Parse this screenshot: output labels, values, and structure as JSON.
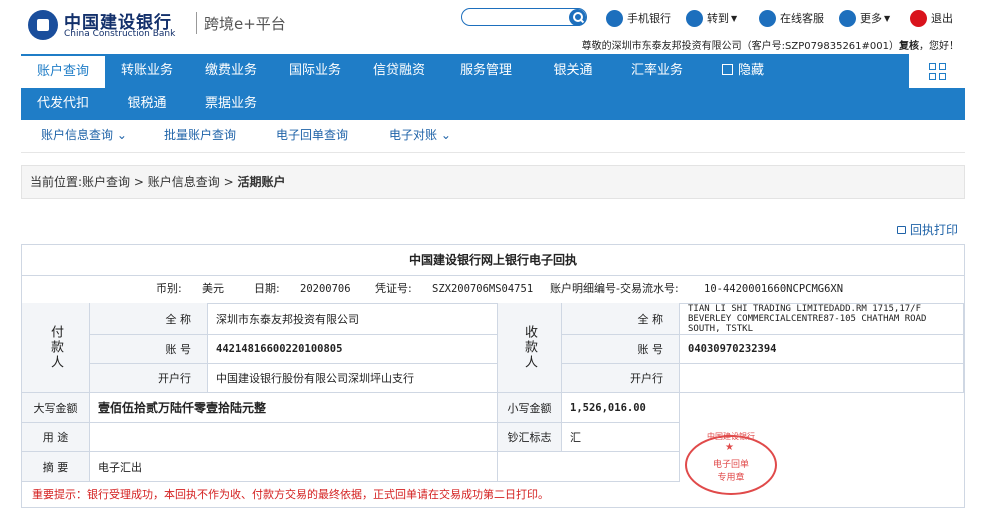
{
  "header": {
    "bank_name_cn": "中国建设银行",
    "bank_name_en": "China Construction Bank",
    "platform": "跨境e+平台",
    "search_placeholder": "",
    "tools": {
      "mobile": "手机银行",
      "goto": "转到",
      "service": "在线客服",
      "more": "更多",
      "logout": "退出"
    },
    "welcome_prefix": "尊敬的深圳市东泰友邦投资有限公司（客户号:SZP079835261#001）",
    "welcome_name": "复核",
    "welcome_suffix": "，您好！"
  },
  "nav": {
    "row1": [
      "账户查询",
      "转账业务",
      "缴费业务",
      "国际业务",
      "信贷融资",
      "服务管理",
      "银关通",
      "汇率业务",
      "隐藏"
    ],
    "row2": [
      "代发代扣",
      "银税通",
      "票据业务"
    ],
    "sub": [
      "账户信息查询",
      "批量账户查询",
      "电子回单查询",
      "电子对账"
    ]
  },
  "breadcrumb": {
    "prefix": "当前位置:",
    "path1": "账户查询",
    "path2": "账户信息查询",
    "current": "活期账户"
  },
  "print_label": "回执打印",
  "receipt": {
    "title": "中国建设银行网上银行电子回执",
    "currency_label": "币别:",
    "currency": "美元",
    "date_label": "日期:",
    "date": "20200706",
    "voucher_label": "凭证号:",
    "voucher": "SZX200706MS04751",
    "detail_label": "账户明细编号-交易流水号:",
    "detail": "10-4420001660NCPCMG6XN",
    "payer": {
      "side_label": "付款人",
      "name_label": "全 称",
      "name": "深圳市东泰友邦投资有限公司",
      "account_label": "账 号",
      "account": "44214816600220100805",
      "bank_label": "开户行",
      "bank": "中国建设银行股份有限公司深圳坪山支行"
    },
    "payee": {
      "side_label": "收款人",
      "name_label": "全 称",
      "name": "TIAN LI SHI TRADING LIMITEDADD.RM 1715,17/F BEVERLEY COMMERCIALCENTRE87-105 CHATHAM ROAD SOUTH, TSTKL",
      "account_label": "账 号",
      "account": "04030970232394",
      "bank_label": "开户行",
      "bank": ""
    },
    "amount_cn_label": "大写金额",
    "amount_cn": "壹佰伍拾贰万陆仟零壹拾陆元整",
    "amount_num_label": "小写金额",
    "amount_num": "1,526,016.00",
    "purpose_label": "用 途",
    "purpose": "",
    "cash_label": "钞汇标志",
    "cash": "汇",
    "memo_label": "摘 要",
    "memo": "电子汇出",
    "notice": "重要提示：银行受理成功，本回执不作为收、付款方交易的最终依据，正式回单请在交易成功第二日打印。",
    "stamp": {
      "ring": "中国建设银行",
      "line1": "电子回单",
      "line2": "专用章"
    }
  },
  "colors": {
    "primary": "#1f7dc7",
    "link": "#1f63a8",
    "notice": "#d42020"
  }
}
